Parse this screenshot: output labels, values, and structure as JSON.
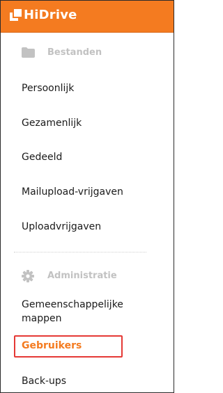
{
  "header": {
    "brand": "HiDrive",
    "logo_icon": "hidrive-logo-icon",
    "color": "#f47b20"
  },
  "sections": {
    "files": {
      "title": "Bestanden",
      "icon": "folder-icon"
    },
    "admin": {
      "title": "Administratie",
      "icon": "gear-icon"
    }
  },
  "nav": {
    "persoonlijk": "Persoonlijk",
    "gezamenlijk": "Gezamenlijk",
    "gedeeld": "Gedeeld",
    "mailupload": "Mailupload-vrijgaven",
    "uploadvrijgaven": "Uploadvrijgaven",
    "gemeenschappelijke": "Gemeenschappelijke mappen",
    "gebruikers": "Gebruikers",
    "backups": "Back-ups"
  },
  "active_item": "Gebruikers",
  "colors": {
    "accent": "#f47b20",
    "highlight": "#e53935",
    "muted": "#c2c2c2"
  }
}
